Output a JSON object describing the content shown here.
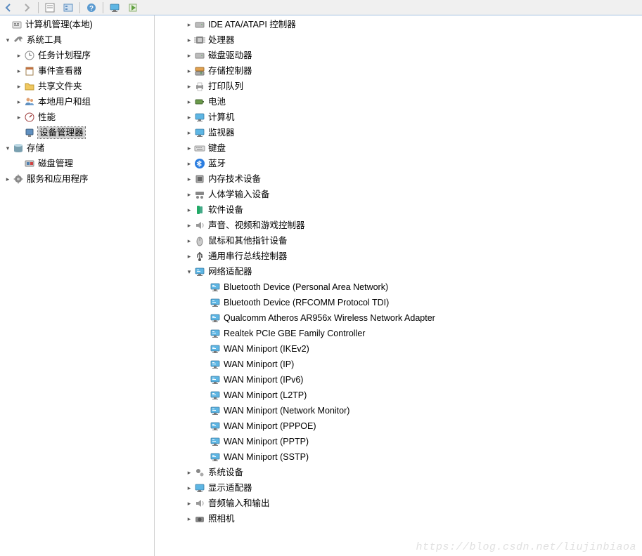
{
  "left": {
    "root": "计算机管理(本地)",
    "sys_tools": "系统工具",
    "task_sched": "任务计划程序",
    "event_viewer": "事件查看器",
    "shared_folders": "共享文件夹",
    "local_users": "本地用户和组",
    "performance": "性能",
    "device_manager": "设备管理器",
    "storage": "存储",
    "disk_mgmt": "磁盘管理",
    "services": "服务和应用程序"
  },
  "right": {
    "ide": "IDE ATA/ATAPI 控制器",
    "processor": "处理器",
    "disk_drives": "磁盘驱动器",
    "storage_ctrl": "存储控制器",
    "print_queue": "打印队列",
    "battery": "电池",
    "computer": "计算机",
    "monitor": "监视器",
    "keyboard": "键盘",
    "bluetooth": "蓝牙",
    "memory_tech": "内存技术设备",
    "hid": "人体学输入设备",
    "software_dev": "软件设备",
    "sound": "声音、视频和游戏控制器",
    "mouse": "鼠标和其他指针设备",
    "usb": "通用串行总线控制器",
    "network": "网络适配器",
    "net_items": [
      "Bluetooth Device (Personal Area Network)",
      "Bluetooth Device (RFCOMM Protocol TDI)",
      "Qualcomm Atheros AR956x Wireless Network Adapter",
      "Realtek PCIe GBE Family Controller",
      "WAN Miniport (IKEv2)",
      "WAN Miniport (IP)",
      "WAN Miniport (IPv6)",
      "WAN Miniport (L2TP)",
      "WAN Miniport (Network Monitor)",
      "WAN Miniport (PPPOE)",
      "WAN Miniport (PPTP)",
      "WAN Miniport (SSTP)"
    ],
    "system_dev": "系统设备",
    "display": "显示适配器",
    "audio_io": "音频输入和输出",
    "camera": "照相机"
  },
  "watermark": "https://blog.csdn.net/liujinbiaoa"
}
